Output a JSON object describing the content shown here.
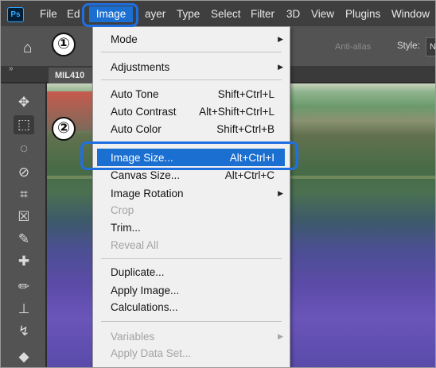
{
  "app": {
    "logo": "Ps"
  },
  "menubar": {
    "items": [
      "File",
      "Ed",
      "Image",
      "ayer",
      "Type",
      "Select",
      "Filter",
      "3D",
      "View",
      "Plugins",
      "Window"
    ],
    "active": "Image"
  },
  "options": {
    "antialias_label": "Anti-alias",
    "style_label": "Style:",
    "style_value": "N"
  },
  "tab": {
    "arrows": "»",
    "doc_name": "MIL410"
  },
  "steps": {
    "one": "①",
    "two": "②"
  },
  "image_menu": {
    "mode": "Mode",
    "adjustments": "Adjustments",
    "auto_tone": "Auto Tone",
    "auto_tone_sc": "Shift+Ctrl+L",
    "auto_contrast": "Auto Contrast",
    "auto_contrast_sc": "Alt+Shift+Ctrl+L",
    "auto_color": "Auto Color",
    "auto_color_sc": "Shift+Ctrl+B",
    "image_size": "Image Size...",
    "image_size_sc": "Alt+Ctrl+I",
    "canvas_size": "Canvas Size...",
    "canvas_size_sc": "Alt+Ctrl+C",
    "image_rotation": "Image Rotation",
    "crop": "Crop",
    "trim": "Trim...",
    "reveal_all": "Reveal All",
    "duplicate": "Duplicate...",
    "apply_image": "Apply Image...",
    "calculations": "Calculations...",
    "variables": "Variables",
    "apply_data_set": "Apply Data Set..."
  },
  "colors": {
    "accent": "#1b6fd1",
    "highlight_border": "#1f6fe0"
  }
}
